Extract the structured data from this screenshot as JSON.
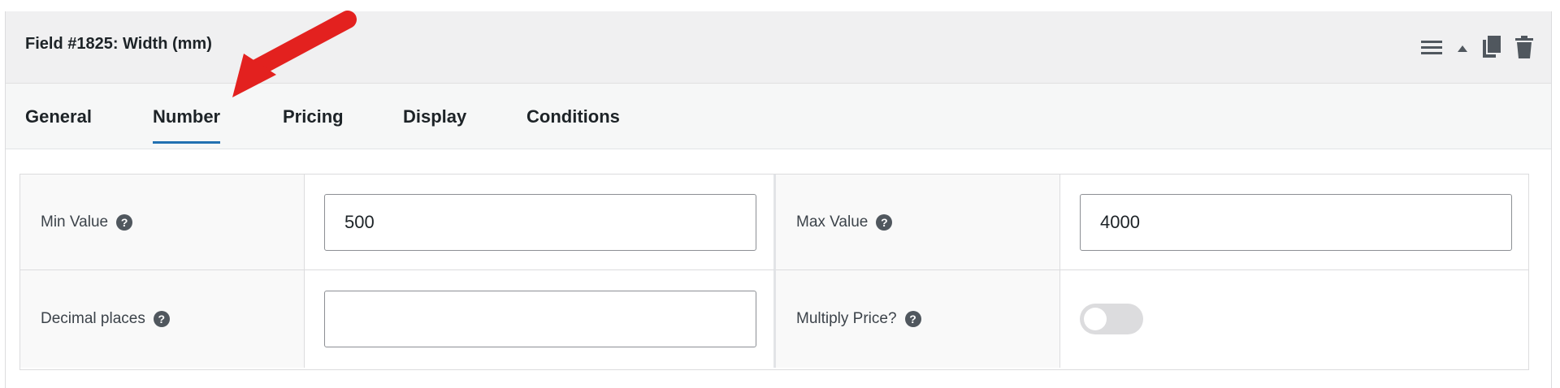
{
  "header": {
    "title": "Field #1825: Width (mm)",
    "icons": [
      "menu-icon",
      "collapse-arrow-icon",
      "duplicate-icon",
      "trash-icon"
    ]
  },
  "tabs": [
    {
      "label": "General",
      "active": false
    },
    {
      "label": "Number",
      "active": true
    },
    {
      "label": "Pricing",
      "active": false
    },
    {
      "label": "Display",
      "active": false
    },
    {
      "label": "Conditions",
      "active": false
    }
  ],
  "fields": {
    "min_value": {
      "label": "Min Value",
      "value": "500"
    },
    "max_value": {
      "label": "Max Value",
      "value": "4000"
    },
    "decimal_places": {
      "label": "Decimal places",
      "value": ""
    },
    "multiply_price": {
      "label": "Multiply Price?",
      "enabled": false
    }
  },
  "colors": {
    "accent": "#2271b1",
    "arrow": "#e3211f",
    "header_bg": "#f0f0f1"
  }
}
